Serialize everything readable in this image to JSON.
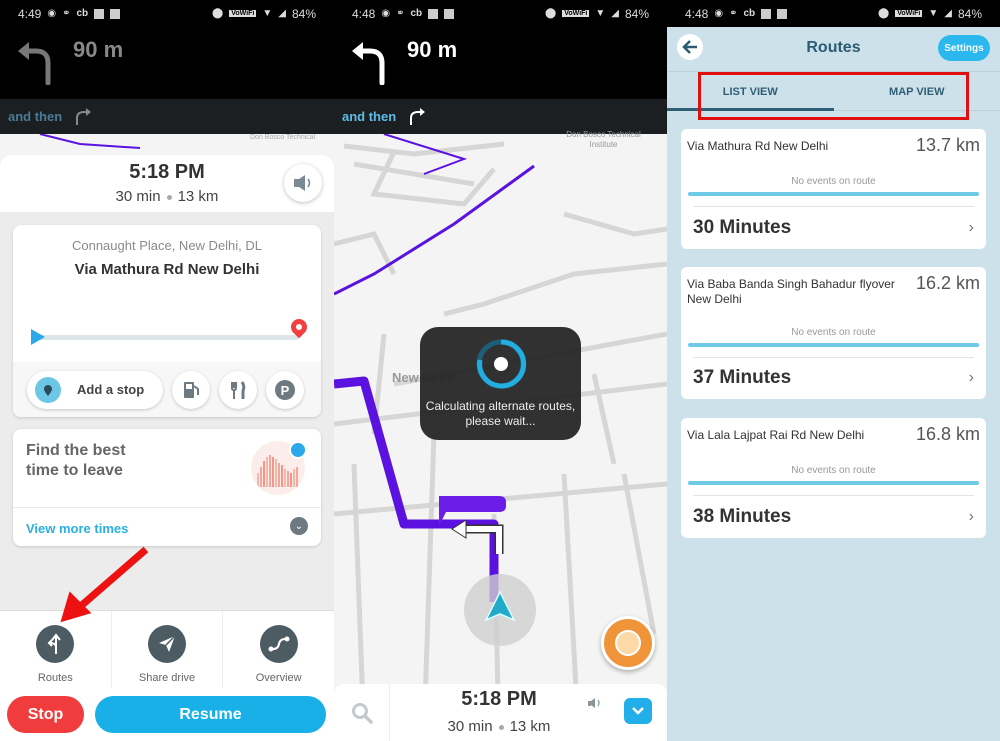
{
  "panels": {
    "p1": {
      "status": {
        "time": "4:49",
        "battery": "84%",
        "carrier": "cb",
        "network_label": "VoWiFi"
      },
      "nav": {
        "distance": "90 m",
        "and_then": "and then"
      },
      "eta": {
        "time": "5:18 PM",
        "duration": "30 min",
        "distance": "13 km"
      },
      "destination": {
        "address": "Connaught Place, New Delhi, DL",
        "via": "Via Mathura Rd New Delhi",
        "progress": 0
      },
      "actions": {
        "add_stop": "Add a stop"
      },
      "leave_card": {
        "title": "Find the best time to leave",
        "view_more": "View more times"
      },
      "bottom_actions": [
        {
          "label": "Routes",
          "icon": "routes-icon"
        },
        {
          "label": "Share drive",
          "icon": "send-icon"
        },
        {
          "label": "Overview",
          "icon": "overview-icon"
        }
      ],
      "buttons": {
        "stop": "Stop",
        "resume": "Resume"
      }
    },
    "p2": {
      "status": {
        "time": "4:48",
        "battery": "84%",
        "carrier": "cb",
        "network_label": "VoWiFi"
      },
      "nav": {
        "distance": "90 m",
        "and_then": "and then"
      },
      "map": {
        "label_city": "New Delhi",
        "label_poi": "Don Bosco Technical Institute"
      },
      "dialog": {
        "text": "Calculating alternate routes, please wait..."
      },
      "eta": {
        "time": "5:18 PM",
        "duration": "30 min",
        "distance": "13 km"
      }
    },
    "p3": {
      "status": {
        "time": "4:48",
        "battery": "84%",
        "carrier": "cb",
        "network_label": "VoWiFi"
      },
      "header": {
        "title": "Routes",
        "settings": "Settings"
      },
      "tabs": [
        {
          "label": "LIST VIEW",
          "active": true
        },
        {
          "label": "MAP VIEW",
          "active": false
        }
      ],
      "routes": [
        {
          "name": "Via Mathura Rd New Delhi",
          "distance": "13.7 km",
          "events": "No events on route",
          "time": "30 Minutes"
        },
        {
          "name": "Via Baba Banda Singh Bahadur flyover New Delhi",
          "distance": "16.2 km",
          "events": "No events on route",
          "time": "37 Minutes"
        },
        {
          "name": "Via Lala Lajpat Rai Rd New Delhi",
          "distance": "16.8 km",
          "events": "No events on route",
          "time": "38 Minutes"
        }
      ]
    }
  },
  "colors": {
    "accent_blue": "#18b0e6",
    "stop_red": "#f03c3c",
    "route_purple": "#5b12e0",
    "annotation_red": "#e01010",
    "routes_bg": "#cde1ea"
  }
}
